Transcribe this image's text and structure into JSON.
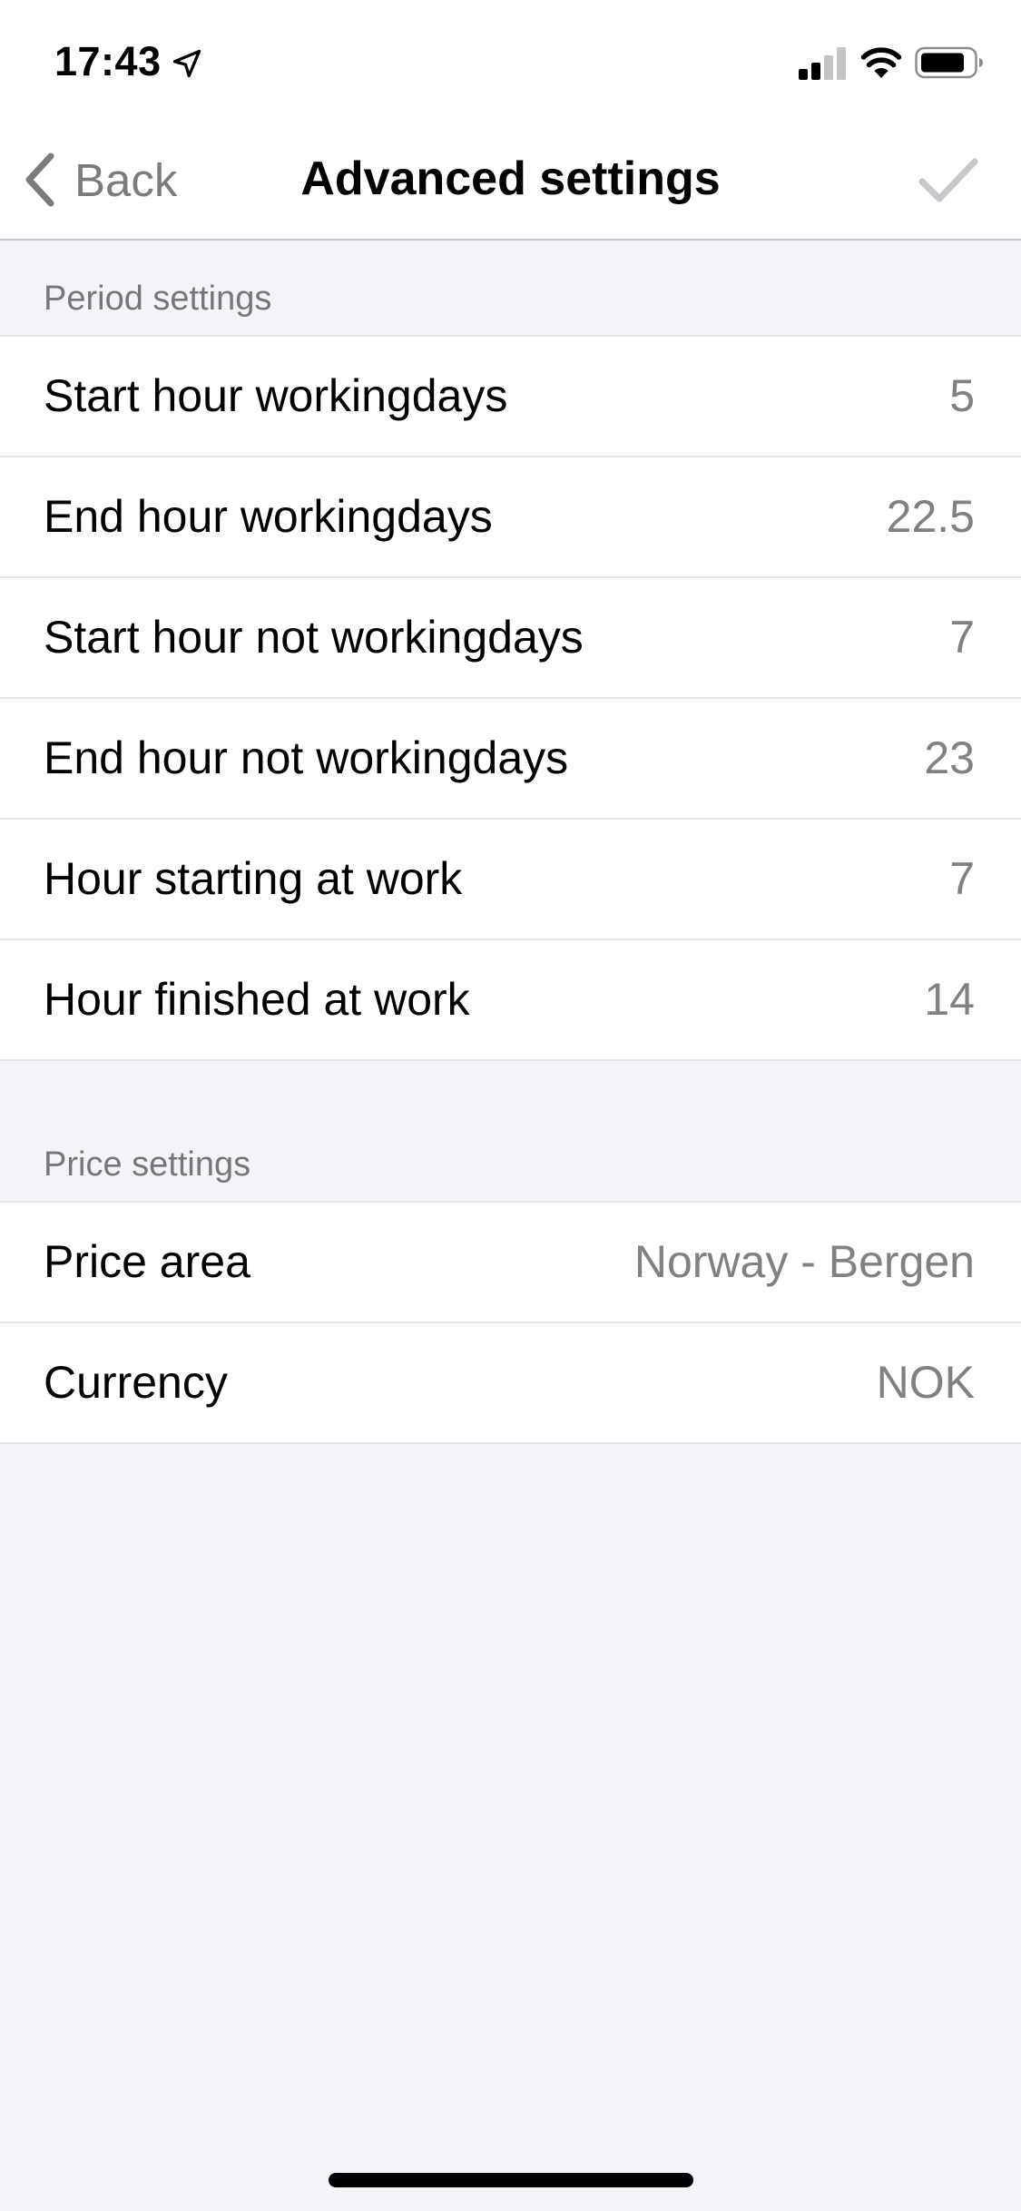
{
  "status_bar": {
    "time": "17:43"
  },
  "nav": {
    "back_label": "Back",
    "title": "Advanced settings"
  },
  "sections": [
    {
      "header": "Period settings",
      "rows": [
        {
          "label": "Start hour workingdays",
          "value": "5"
        },
        {
          "label": "End hour workingdays",
          "value": "22.5"
        },
        {
          "label": "Start hour not workingdays",
          "value": "7"
        },
        {
          "label": "End hour not workingdays",
          "value": "23"
        },
        {
          "label": "Hour starting at work",
          "value": "7"
        },
        {
          "label": "Hour finished at work",
          "value": "14"
        }
      ]
    },
    {
      "header": "Price settings",
      "rows": [
        {
          "label": "Price area",
          "value": "Norway - Bergen"
        },
        {
          "label": "Currency",
          "value": "NOK"
        }
      ]
    }
  ],
  "icons": {
    "back": "chevron-left-icon",
    "confirm": "checkmark-icon",
    "location": "location-arrow-icon",
    "signal": "cellular-signal-icon",
    "wifi": "wifi-icon",
    "battery": "battery-icon"
  },
  "colors": {
    "background": "#f3f4f7",
    "card": "#ffffff",
    "secondary_text": "#808085",
    "disabled_icon": "#c7c7cc"
  }
}
